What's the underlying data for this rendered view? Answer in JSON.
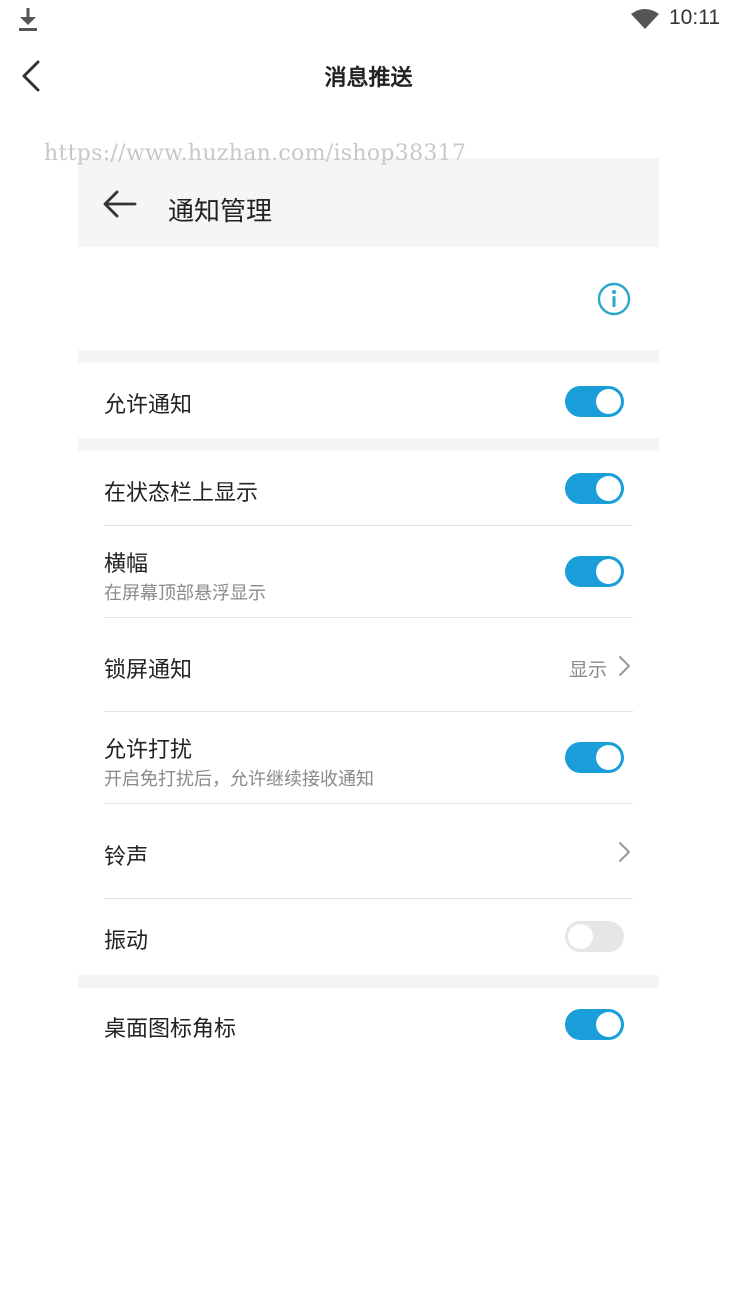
{
  "status_bar": {
    "time": "10:11",
    "icons": [
      "download-icon",
      "wifi-icon"
    ]
  },
  "header": {
    "title": "消息推送",
    "back_icon": "chevron-left-icon"
  },
  "watermark": "https://www.huzhan.com/ishop38317",
  "panel": {
    "title": "通知管理",
    "back_icon": "arrow-left-icon",
    "info_icon": "info-icon"
  },
  "settings": {
    "allow_notification": {
      "label": "允许通知",
      "enabled": true
    },
    "status_bar_display": {
      "label": "在状态栏上显示",
      "enabled": true
    },
    "banner": {
      "label": "横幅",
      "description": "在屏幕顶部悬浮显示",
      "enabled": true
    },
    "lockscreen": {
      "label": "锁屏通知",
      "value": "显示"
    },
    "allow_dnd": {
      "label": "允许打扰",
      "description": "开启免打扰后，允许继续接收通知",
      "enabled": true
    },
    "ringtone": {
      "label": "铃声"
    },
    "vibration": {
      "label": "振动",
      "enabled": false
    },
    "badge": {
      "label": "桌面图标角标",
      "enabled": true
    }
  },
  "colors": {
    "accent": "#1a9ed9",
    "section_bg": "#f4f5f5",
    "toggle_off": "#e6e6e6",
    "info_icon": "#2aa7c9"
  }
}
